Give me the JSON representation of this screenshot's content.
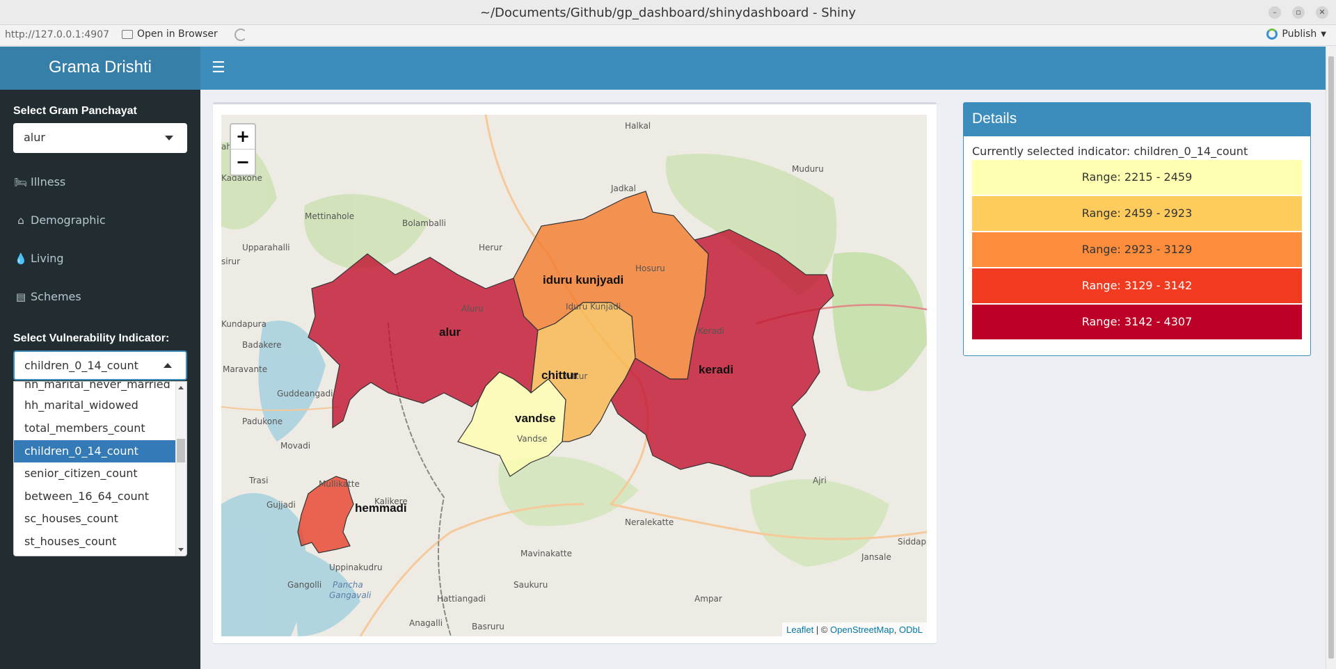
{
  "window": {
    "title": "~/Documents/Github/gp_dashboard/shinydashboard - Shiny",
    "controls": [
      "–",
      "▫",
      "✕"
    ]
  },
  "viewer_toolbar": {
    "url": "http://127.0.0.1:4907",
    "open_in_browser": "Open in Browser",
    "publish": "Publish"
  },
  "header": {
    "app_title": "Grama Drishti",
    "toggle_icon": "☰"
  },
  "sidebar": {
    "gp_label": "Select Gram Panchayat",
    "gp_value": "alur",
    "menu": [
      {
        "label": "Illness",
        "icon": "bed-icon"
      },
      {
        "label": "Demographic",
        "icon": "home-icon"
      },
      {
        "label": "Living",
        "icon": "tint-icon"
      },
      {
        "label": "Schemes",
        "icon": "newspaper-icon"
      }
    ],
    "indicator_label": "Select Vulnerability Indicator:",
    "indicator_value": "children_0_14_count",
    "dropdown_options": [
      "hh_marital_never_married",
      "hh_marital_widowed",
      "total_members_count",
      "children_0_14_count",
      "senior_citizen_count",
      "between_16_64_count",
      "sc_houses_count",
      "st_houses_count"
    ],
    "dropdown_selected": "children_0_14_count"
  },
  "map": {
    "zoom_in": "+",
    "zoom_out": "−",
    "attribution_leaflet": "Leaflet",
    "attribution_sep": " | © ",
    "attribution_osm": "OpenStreetMap",
    "attribution_odbl": "ODbL",
    "regions": [
      {
        "name": "alur",
        "color": "#c0112e"
      },
      {
        "name": "iduru kunjyadi",
        "color": "#f47b2a"
      },
      {
        "name": "chittur",
        "color": "#f9b74e"
      },
      {
        "name": "vandse",
        "color": "#ffffb2"
      },
      {
        "name": "keradi",
        "color": "#c0112e"
      },
      {
        "name": "hemmadi",
        "color": "#e8412b"
      }
    ],
    "place_labels": [
      "Halkal",
      "Muduru",
      "Jadkal",
      "Mettinahole",
      "Bolamballi",
      "Upparahalli",
      "Herur",
      "Hosuru",
      "Aluru",
      "Iduru Kunjadi",
      "Keradi",
      "Badakere",
      "Maravante",
      "Guddeangadi",
      "Padukone",
      "Movadi",
      "Trasi",
      "Mullikatte",
      "Kalikere",
      "Gujjadi",
      "Ajri",
      "Neralekatte",
      "Mavinakatte",
      "Jansale",
      "Siddapura",
      "Uppinakudru",
      "Gangolli",
      "Pancha Gangavali",
      "Saukuru",
      "Hattiangadi",
      "Ampar",
      "Anagalli",
      "Basruru",
      "Vandse",
      "Chittur",
      "sirur",
      "ahavara",
      "Kadakone",
      "Kundapura"
    ]
  },
  "details": {
    "title": "Details",
    "indicator_prefix": "Currently selected indicator: ",
    "indicator": "children_0_14_count",
    "ranges": [
      {
        "label": "Range: 2215 - 2459",
        "color": "#ffffb2",
        "text_color": "#333333"
      },
      {
        "label": "Range: 2459 - 2923",
        "color": "#fecc5c",
        "text_color": "#333333"
      },
      {
        "label": "Range: 2923 - 3129",
        "color": "#fd8d3c",
        "text_color": "#333333"
      },
      {
        "label": "Range: 3129 - 3142",
        "color": "#f03b20",
        "text_color": "#ffffff"
      },
      {
        "label": "Range: 3142 - 4307",
        "color": "#bd0026",
        "text_color": "#ffffff"
      }
    ]
  }
}
